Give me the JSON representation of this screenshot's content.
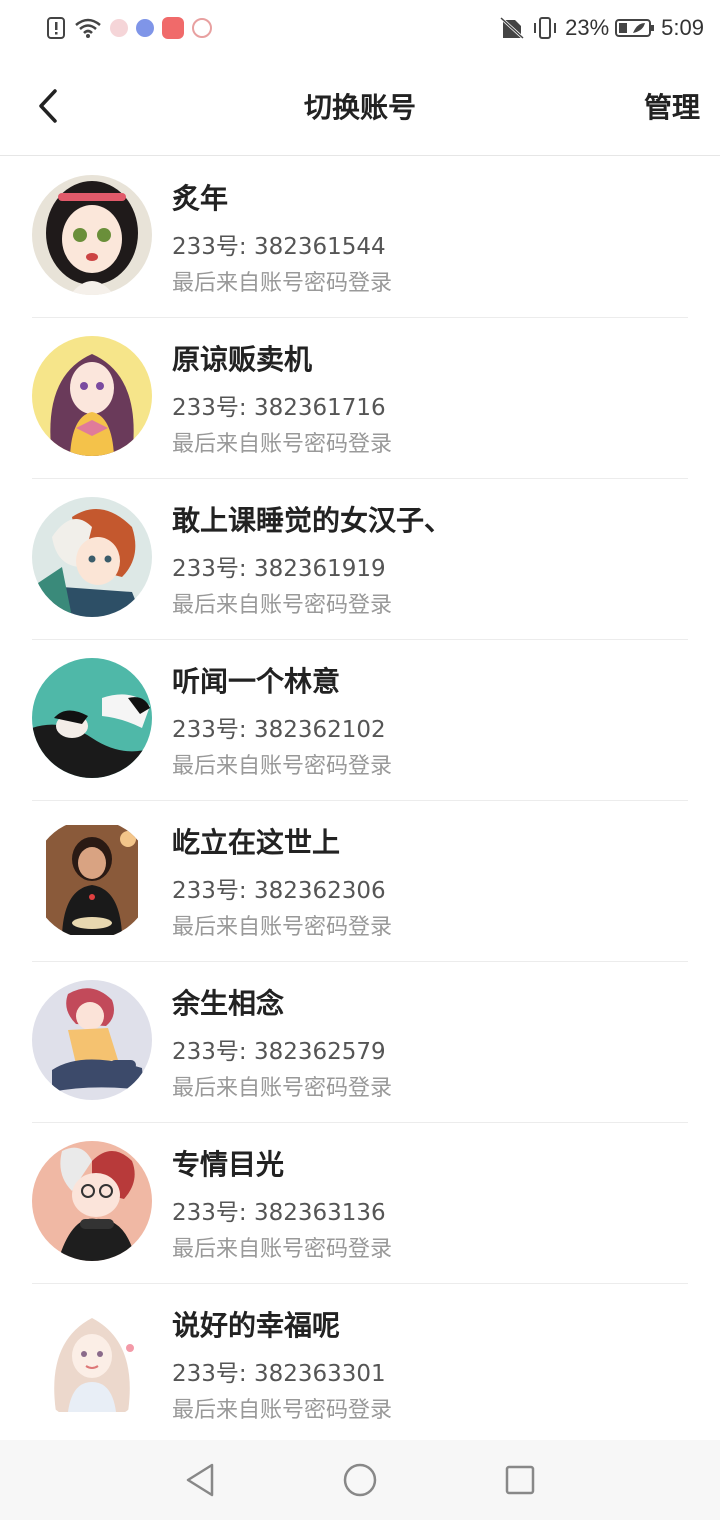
{
  "status_bar": {
    "battery_text": "23%",
    "time": "5:09"
  },
  "header": {
    "title": "切换账号",
    "manage_label": "管理"
  },
  "accounts": [
    {
      "name": "炙年",
      "id_prefix": "233号: ",
      "id": "382361544",
      "login": "最后来自账号密码登录"
    },
    {
      "name": "原谅贩卖机",
      "id_prefix": "233号: ",
      "id": "382361716",
      "login": "最后来自账号密码登录"
    },
    {
      "name": "敢上课睡觉的女汉子、",
      "id_prefix": "233号: ",
      "id": "382361919",
      "login": "最后来自账号密码登录"
    },
    {
      "name": "听闻一个林意",
      "id_prefix": "233号: ",
      "id": "382362102",
      "login": "最后来自账号密码登录"
    },
    {
      "name": "屹立在这世上",
      "id_prefix": "233号: ",
      "id": "382362306",
      "login": "最后来自账号密码登录"
    },
    {
      "name": "余生相念",
      "id_prefix": "233号: ",
      "id": "382362579",
      "login": "最后来自账号密码登录"
    },
    {
      "name": "专情目光",
      "id_prefix": "233号: ",
      "id": "382363136",
      "login": "最后来自账号密码登录"
    },
    {
      "name": "说好的幸福呢",
      "id_prefix": "233号: ",
      "id": "382363301",
      "login": "最后来自账号密码登录"
    }
  ],
  "icons": {
    "back": "chevron-left-icon",
    "nav_back": "triangle-back-icon",
    "nav_home": "circle-home-icon",
    "nav_recent": "square-recent-icon"
  },
  "colors": {
    "title_text": "#222222",
    "secondary_text": "#555555",
    "hint_text": "#999999",
    "divider": "#ececec",
    "nav_bar_bg": "#f7f7f7"
  }
}
